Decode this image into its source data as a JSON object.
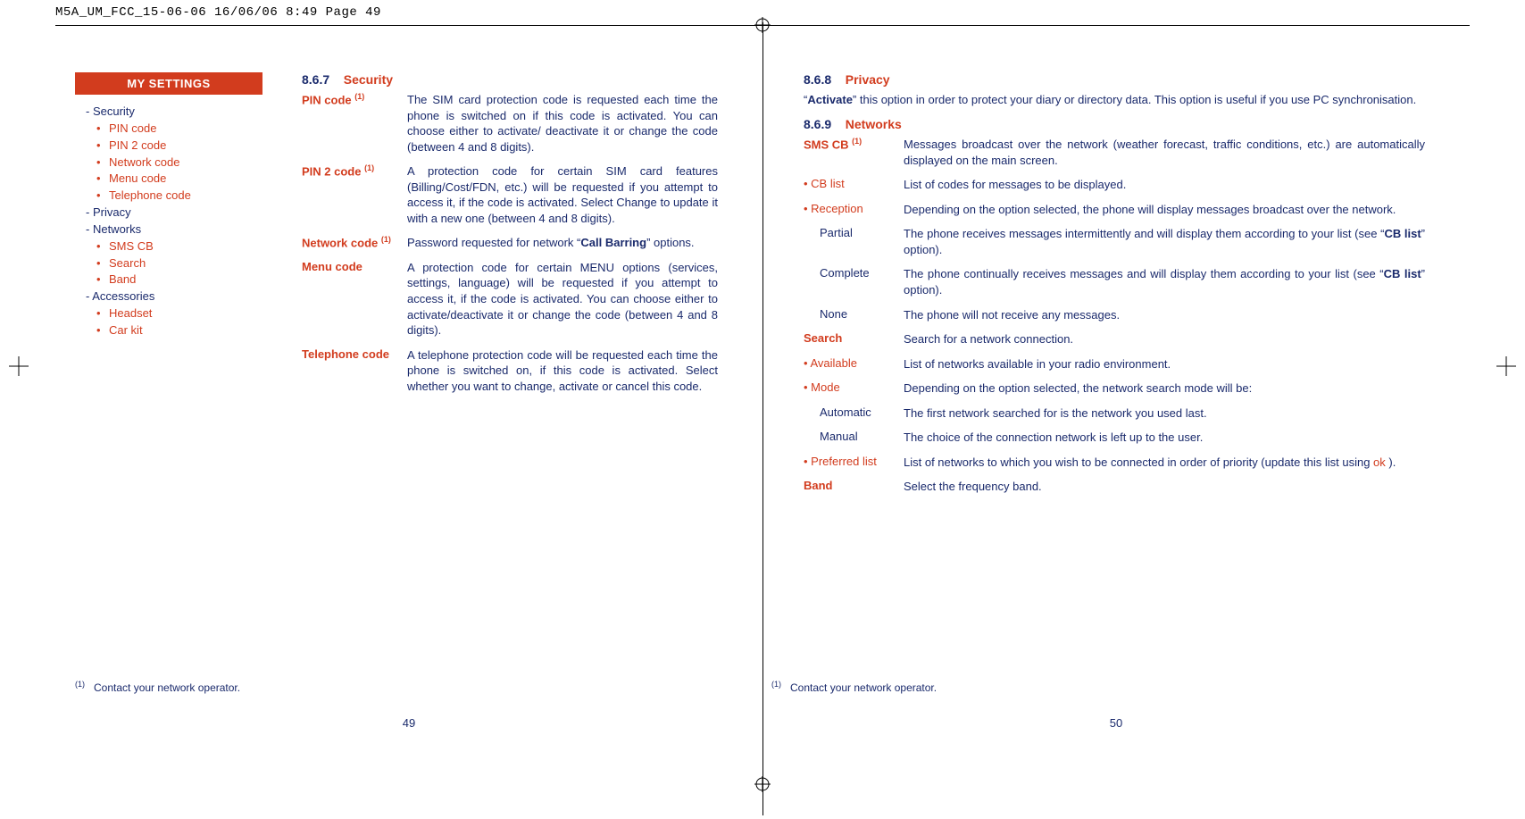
{
  "print_header": "M5A_UM_FCC_15-06-06  16/06/06  8:49  Page 49",
  "sidebar": {
    "header": "MY SETTINGS",
    "groups": [
      {
        "label": "Security",
        "items": [
          "PIN code",
          "PIN 2 code",
          "Network code",
          "Menu code",
          "Telephone code"
        ]
      },
      {
        "label": "Privacy",
        "items": []
      },
      {
        "label": "Networks",
        "items": [
          "SMS CB",
          "Search",
          "Band"
        ]
      },
      {
        "label": "Accessories",
        "items": [
          "Headset",
          "Car kit"
        ]
      }
    ]
  },
  "left": {
    "section_num": "8.6.7",
    "section_title": "Security",
    "defs": [
      {
        "term": "PIN code",
        "note": "(1)",
        "desc": "The SIM card protection code is requested each time the phone is switched on if this code is activated. You can choose either to activate/ deactivate it or change the code (between 4 and 8 digits)."
      },
      {
        "term": "PIN 2 code",
        "note": "(1)",
        "desc": "A protection code for certain SIM card features (Billing/Cost/FDN, etc.) will be requested if you attempt to access it, if the code is activated. Select Change to update it with a new one (between 4 and 8 digits)."
      },
      {
        "term": "Network code",
        "note": "(1)",
        "desc_pre": "Password requested for network “",
        "desc_bold": "Call Barring",
        "desc_post": "” options."
      },
      {
        "term": "Menu code",
        "note": "",
        "desc": "A protection code for certain MENU options (services, settings, language) will be requested if you attempt to access it, if the code is activated. You can choose either to activate/deactivate it or change the code (between 4 and 8 digits)."
      },
      {
        "term": "Telephone code",
        "note": "",
        "desc": "A telephone protection code will be requested each time the phone is switched on, if this code is activated. Select whether you want to change, activate or cancel this code."
      }
    ],
    "footnote_mark": "(1)",
    "footnote": "Contact your network operator.",
    "page_num": "49"
  },
  "right": {
    "privacy_num": "8.6.8",
    "privacy_title": "Privacy",
    "privacy_para_pre": "“",
    "privacy_para_bold": "Activate",
    "privacy_para_post": "” this option in order to protect your diary or directory data. This option is useful if you use PC synchronisation.",
    "networks_num": "8.6.9",
    "networks_title": "Networks",
    "rows": [
      {
        "cls": "boldterm",
        "term": "SMS CB",
        "note": "(1)",
        "desc": "Messages broadcast over the network (weather forecast, traffic conditions, etc.) are automatically displayed on the main screen."
      },
      {
        "cls": "indent1",
        "term": "• CB list",
        "desc": "List of codes for messages to be displayed."
      },
      {
        "cls": "indent1",
        "term": "• Reception",
        "desc": "Depending on the option selected, the phone will display messages broadcast over the network."
      },
      {
        "cls": "indent2",
        "term": "Partial",
        "desc_pre": "The phone receives messages intermittently and will display them according to your list (see “",
        "desc_bold": "CB list",
        "desc_post": "” option)."
      },
      {
        "cls": "indent2",
        "term": "Complete",
        "desc_pre": "The phone continually receives messages and will display them according to your list (see “",
        "desc_bold": "CB list",
        "desc_post": "” option)."
      },
      {
        "cls": "indent2",
        "term": "None",
        "desc": "The phone will not receive any messages."
      },
      {
        "cls": "boldterm",
        "term": "Search",
        "desc": "Search for a network connection."
      },
      {
        "cls": "indent1",
        "term": "• Available",
        "desc": "List of networks available in your radio environment."
      },
      {
        "cls": "indent1",
        "term": "• Mode",
        "desc": "Depending on the option selected, the network search mode will be:"
      },
      {
        "cls": "indent2",
        "term": "Automatic",
        "desc": "The first network searched for is the network you used last."
      },
      {
        "cls": "indent2",
        "term": "Manual",
        "desc": "The choice of the connection network is left up to the user."
      },
      {
        "cls": "indent1",
        "term": "• Preferred list",
        "desc_pre": "List of networks to which you wish to be connected in order of priority (update this list using ",
        "desc_ok": "ok",
        "desc_post": " )."
      },
      {
        "cls": "boldterm",
        "term": "Band",
        "desc": "Select the frequency band."
      }
    ],
    "footnote_mark": "(1)",
    "footnote": "Contact your network operator.",
    "page_num": "50"
  }
}
